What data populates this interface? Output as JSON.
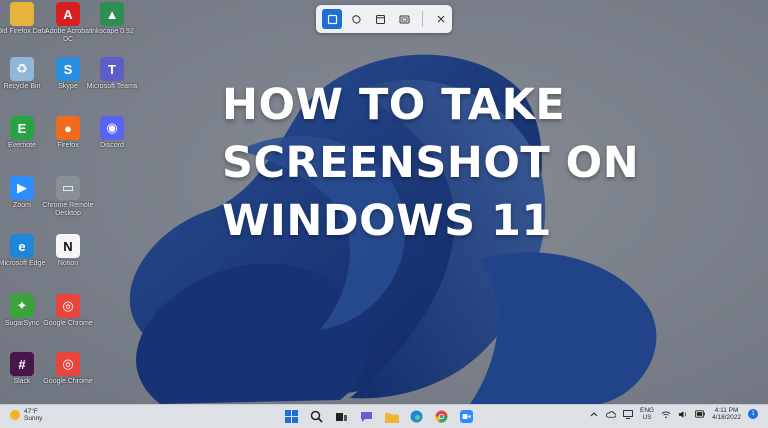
{
  "headline": [
    "HOW TO TAKE",
    "SCREENSHOT ON",
    "WINDOWS 11"
  ],
  "desktop_icons": [
    {
      "label": "Old Firefox Data",
      "icon": "folder-icon",
      "color": "#e6b33b",
      "glyph": ""
    },
    {
      "label": "Adobe Acrobat DC",
      "icon": "acrobat-icon",
      "color": "#d6201f",
      "glyph": "A"
    },
    {
      "label": "Inkscape 0.92",
      "icon": "inkscape-icon",
      "color": "#2d8f52",
      "glyph": "▲"
    },
    {
      "label": "Recycle Bin",
      "icon": "recycle-bin-icon",
      "color": "#8fb8d8",
      "glyph": "♻"
    },
    {
      "label": "Skype",
      "icon": "skype-icon",
      "color": "#2b8fe0",
      "glyph": "S"
    },
    {
      "label": "Microsoft Teams",
      "icon": "teams-icon",
      "color": "#5b5fc7",
      "glyph": "T"
    },
    {
      "label": "Evernote",
      "icon": "evernote-icon",
      "color": "#2aa246",
      "glyph": "E"
    },
    {
      "label": "Firefox",
      "icon": "firefox-icon",
      "color": "#f26b1d",
      "glyph": "●"
    },
    {
      "label": "Discord",
      "icon": "discord-icon",
      "color": "#5865f2",
      "glyph": "◉"
    },
    {
      "label": "Zoom",
      "icon": "zoom-icon",
      "color": "#2d8cff",
      "glyph": "▶"
    },
    {
      "label": "Chrome Remote Desktop",
      "icon": "chrome-remote-desktop-icon",
      "color": "#888f99",
      "glyph": "▭"
    },
    {
      "label": "",
      "icon": "blank-icon",
      "color": "transparent",
      "glyph": ""
    },
    {
      "label": "Microsoft Edge",
      "icon": "edge-icon",
      "color": "#1e88d6",
      "glyph": "e"
    },
    {
      "label": "Notion",
      "icon": "notion-icon",
      "color": "#f5f5f5",
      "glyph": "N"
    },
    {
      "label": "",
      "icon": "blank-icon",
      "color": "transparent",
      "glyph": ""
    },
    {
      "label": "SugarSync",
      "icon": "sugarsync-icon",
      "color": "#3ca33c",
      "glyph": "✦"
    },
    {
      "label": "Google Chrome",
      "icon": "chrome-icon",
      "color": "#e8453c",
      "glyph": "◎"
    },
    {
      "label": "",
      "icon": "blank-icon",
      "color": "transparent",
      "glyph": ""
    },
    {
      "label": "Slack",
      "icon": "slack-icon",
      "color": "#4a154b",
      "glyph": "#"
    },
    {
      "label": "Google Chrome",
      "icon": "chrome-icon",
      "color": "#e8453c",
      "glyph": "◎"
    }
  ],
  "weather": {
    "temp": "47°F",
    "condition": "Sunny"
  },
  "tray": {
    "lang_top": "ENG",
    "lang_bottom": "US",
    "time": "4:11 PM",
    "date": "4/18/2022",
    "notifications": "1"
  },
  "colors": {
    "accent": "#1d6ed8",
    "bloom": "#1f4fbf"
  }
}
